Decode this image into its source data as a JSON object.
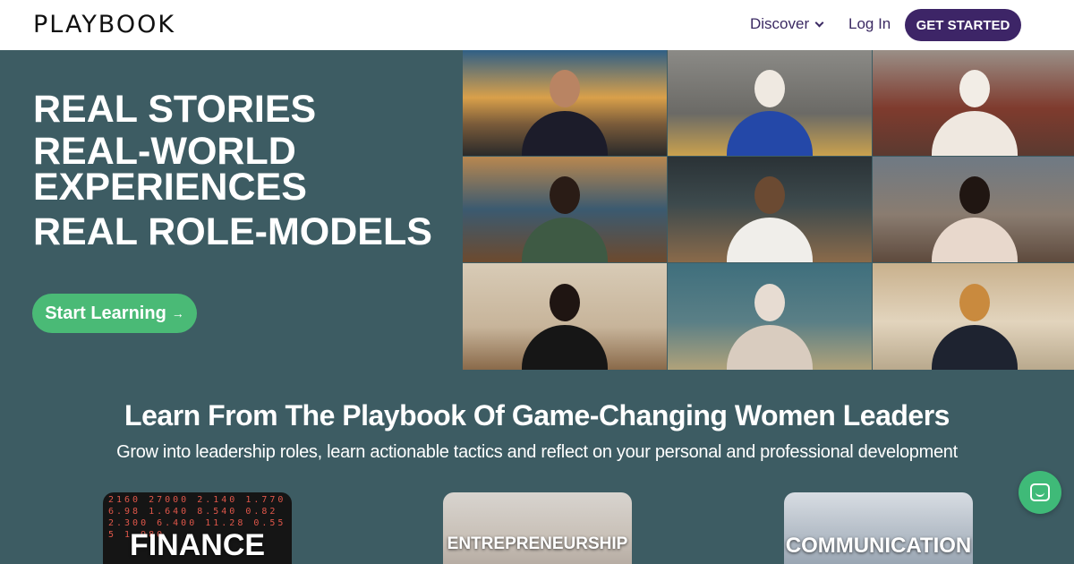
{
  "header": {
    "logo": "PLAYBOOK",
    "nav_discover": "Discover",
    "nav_login": "Log In",
    "cta": "GET STARTED"
  },
  "hero": {
    "lines": [
      "REAL STORIES",
      "REAL-WORLD EXPERIENCES",
      "REAL ROLE-MODELS"
    ],
    "button": "Start Learning",
    "button_icon": "arrow-right-icon"
  },
  "section": {
    "title": "Learn From The Playbook Of Game-Changing Women Leaders",
    "subtitle": "Grow into leadership roles, learn actionable tactics and reflect on your personal and professional development"
  },
  "categories": [
    {
      "label": "FINANCE"
    },
    {
      "label": "ENTREPRENEURSHIP"
    },
    {
      "label": "COMMUNICATION"
    }
  ],
  "finance_ticker": "2160 27000 2.140 1.770 6.98 1.640 8.540 0.82 2.300 6.400 11.28 0.555 1.980",
  "colors": {
    "header_bg": "#ffffff",
    "page_bg": "#3d5c63",
    "nav_text": "#3b2a63",
    "cta_bg": "#3d2567",
    "learn_btn": "#4aba76",
    "chat_btn": "#3fba78"
  },
  "chat_icon": "chat-bubble-icon"
}
